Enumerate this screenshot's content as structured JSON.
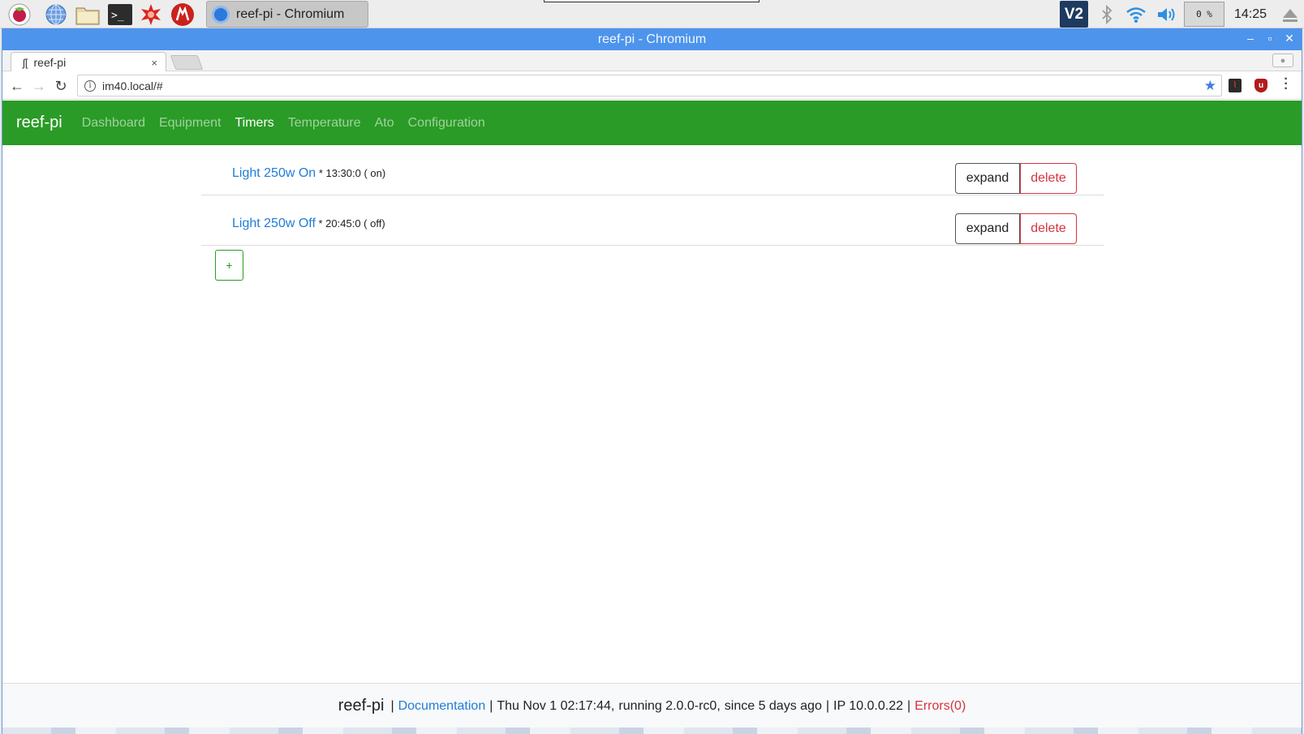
{
  "taskbar": {
    "task_label": "reef-pi - Chromium",
    "cpu_label": "0 %",
    "clock": "14:25",
    "vnc_label": "V2"
  },
  "window": {
    "title": "reef-pi - Chromium",
    "controls": {
      "minimize": "–",
      "maximize": "▫",
      "close": "✕"
    }
  },
  "browser": {
    "tab": {
      "title": "reef-pi",
      "favicon": "ʃ[",
      "close": "×"
    },
    "url": "im40.local/#",
    "info_glyph": "i"
  },
  "app": {
    "brand": "reef-pi",
    "nav": [
      "Dashboard",
      "Equipment",
      "Timers",
      "Temperature",
      "Ato",
      "Configuration"
    ],
    "active_nav": "Timers",
    "timers": [
      {
        "name": "Light 250w On",
        "detail": "* 13:30:0 ( on)",
        "expand_label": "expand",
        "delete_label": "delete"
      },
      {
        "name": "Light 250w Off",
        "detail": "* 20:45:0 ( off)",
        "expand_label": "expand",
        "delete_label": "delete"
      }
    ],
    "add_label": "+"
  },
  "footer": {
    "brand": "reef-pi",
    "sep1": "|",
    "documentation": "Documentation",
    "sep2": "|",
    "time": "Thu Nov 1 02:17:44,",
    "running": "running 2.0.0-rc0,",
    "since": "since 5 days ago",
    "sep3": "|",
    "ip": "IP 10.0.0.22",
    "sep4": "|",
    "errors": "Errors(0)"
  },
  "colors": {
    "navbar": "#2a9b26",
    "link": "#1f7dd6",
    "danger": "#d5343f",
    "titlebar": "#4d94ed"
  },
  "icons": [
    "raspberry-icon",
    "web-browser-icon",
    "file-manager-icon",
    "terminal-icon",
    "math-icon",
    "wolfram-icon",
    "bluetooth-icon",
    "wifi-icon",
    "volume-icon",
    "eject-icon"
  ]
}
